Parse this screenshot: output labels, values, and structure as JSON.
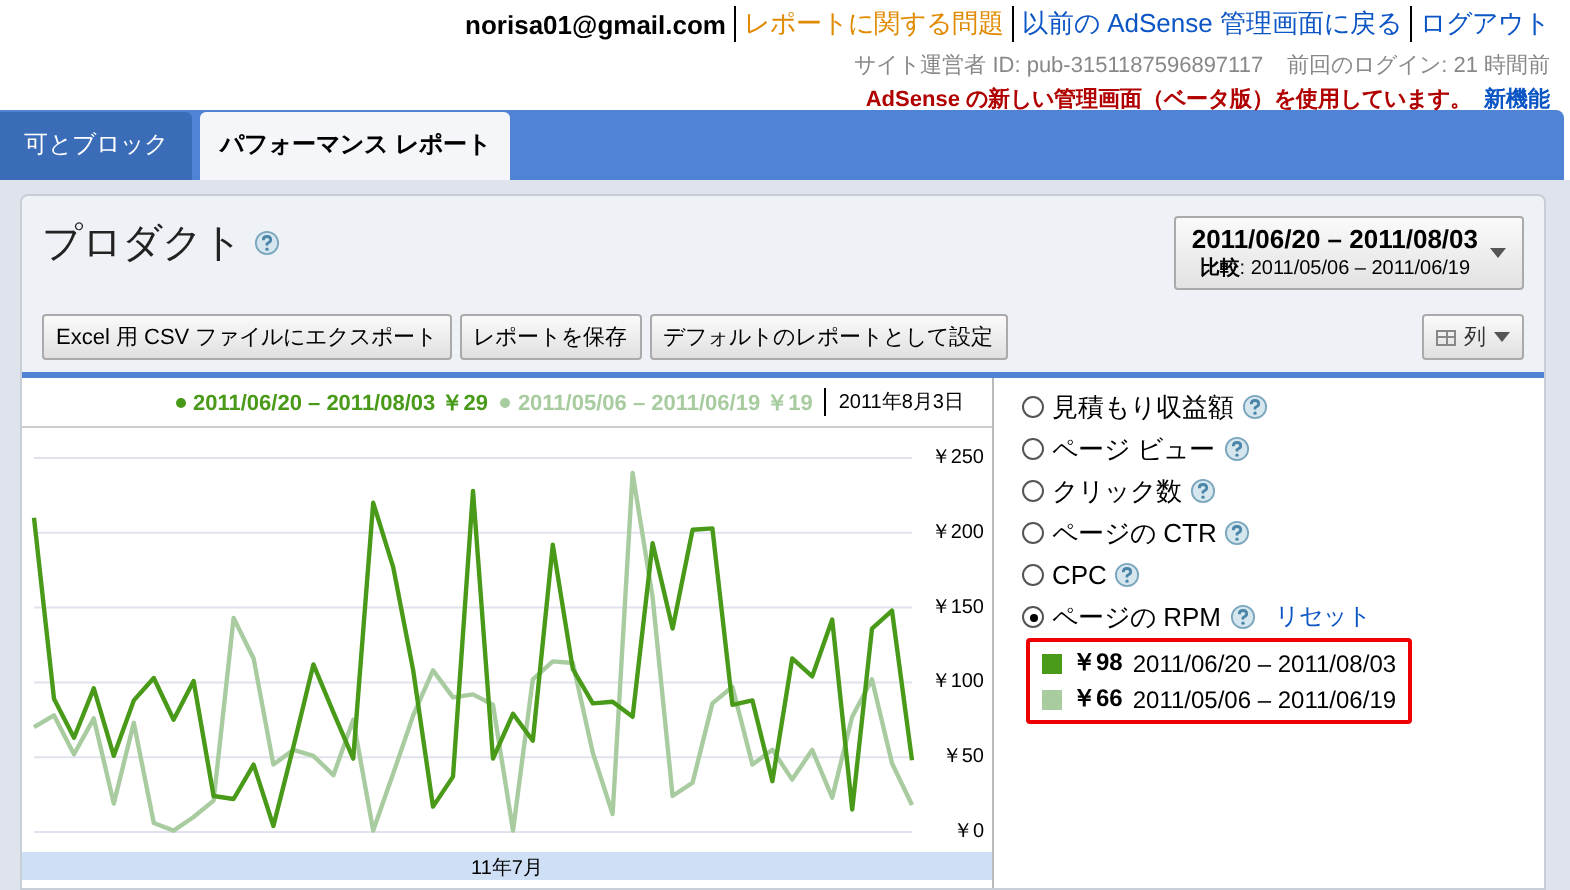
{
  "header": {
    "account": "norisa01@gmail.com",
    "links": [
      {
        "text": "レポートに関する問題",
        "color": "#e08a00"
      },
      {
        "text": "以前の AdSense 管理画面に戻る",
        "color": "#0b55c4"
      },
      {
        "text": "ログアウト",
        "color": "#0b55c4"
      }
    ],
    "publisher_id": "サイト運営者 ID: pub-3151187596897117",
    "last_login": "前回のログイン: 21 時間前",
    "notice": "AdSense の新しい管理画面（ベータ版）を使用しています。",
    "notice_link": "新機能"
  },
  "tabs": [
    {
      "label": "可とブロック",
      "selected": false
    },
    {
      "label": "パフォーマンス レポート",
      "selected": true
    }
  ],
  "report": {
    "title": "プロダクト",
    "date_range": {
      "primary": "2011/06/20 – 2011/08/03",
      "compare_label": "比較",
      "compare": ": 2011/05/06 – 2011/06/19"
    },
    "buttons": [
      "Excel 用 CSV ファイルにエクスポート",
      "レポートを保存",
      "デフォルトのレポートとして設定"
    ],
    "columns_button": "列",
    "legend": {
      "values": [
        "￥29",
        "￥19"
      ],
      "date": "2011年8月3日"
    },
    "chart_data": {
      "type": "line",
      "series": [
        {
          "name": "2011/06/20 – 2011/08/03",
          "color": "#4a9a1a",
          "values": [
            210,
            89,
            63,
            96,
            51,
            88,
            103,
            75,
            101,
            24,
            22,
            45,
            4,
            57,
            112,
            80,
            49,
            220,
            177,
            108,
            17,
            37,
            228,
            49,
            79,
            61,
            192,
            109,
            86,
            87,
            77,
            193,
            136,
            202,
            203,
            85,
            88,
            34,
            116,
            104,
            142,
            15,
            136,
            148,
            48
          ]
        },
        {
          "name": "2011/05/06 – 2011/06/19",
          "color": "#a8cca0",
          "values": [
            70,
            78,
            52,
            76,
            19,
            73,
            6,
            1,
            10,
            21,
            143,
            116,
            45,
            55,
            51,
            38,
            75,
            1,
            39,
            78,
            108,
            90,
            92,
            85,
            1,
            102,
            114,
            113,
            53,
            12,
            240,
            157,
            24,
            33,
            86,
            97,
            45,
            55,
            35,
            55,
            23,
            77,
            102,
            46,
            18
          ]
        }
      ],
      "ylim": [
        0,
        250
      ],
      "yticks": [
        {
          "value": 0,
          "label": "￥0"
        },
        {
          "value": 50,
          "label": "￥50"
        },
        {
          "value": 100,
          "label": "￥100"
        },
        {
          "value": 150,
          "label": "￥150"
        },
        {
          "value": 200,
          "label": "￥200"
        },
        {
          "value": 250,
          "label": "￥250"
        }
      ],
      "xlabel": "11年7月",
      "grid": true
    },
    "metrics": [
      {
        "label": "見積もり収益額",
        "selected": false
      },
      {
        "label": "ページ ビュー",
        "selected": false
      },
      {
        "label": "クリック数",
        "selected": false
      },
      {
        "label": "ページの CTR",
        "selected": false
      },
      {
        "label": "CPC",
        "selected": false
      },
      {
        "label": "ページの RPM",
        "selected": true,
        "action": "リセット"
      }
    ],
    "summary": [
      {
        "value": "￥98",
        "range": "2011/06/20 – 2011/08/03",
        "color": "#4a9a1a"
      },
      {
        "value": "￥66",
        "range": "2011/05/06 – 2011/06/19",
        "color": "#a8cca0"
      }
    ]
  }
}
